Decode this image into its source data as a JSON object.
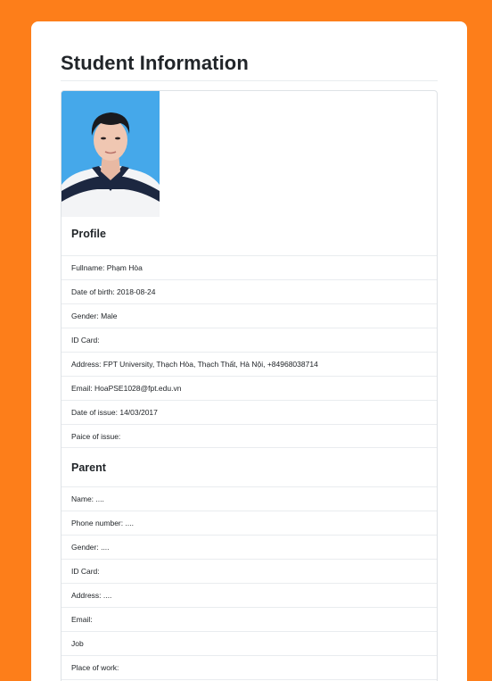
{
  "page": {
    "title": "Student Information",
    "background_color": "#fd7e1a"
  },
  "photo": {
    "alt": "student-photo"
  },
  "profile": {
    "heading": "Profile",
    "rows": [
      {
        "label": "Fullname: ",
        "value": "Phạm Hòa"
      },
      {
        "label": "Date of birth: ",
        "value": "2018-08-24"
      },
      {
        "label": "Gender: ",
        "value": "Male"
      },
      {
        "label": "ID Card: ",
        "value": ""
      },
      {
        "label": "Address: ",
        "value": "FPT University, Thạch Hòa, Thạch Thất, Hà Nội, +84968038714"
      },
      {
        "label": "Email: ",
        "value": "HoaPSE1028@fpt.edu.vn"
      },
      {
        "label": "Date of issue: ",
        "value": "14/03/2017"
      },
      {
        "label": "Paice of issue: ",
        "value": ""
      }
    ]
  },
  "parent": {
    "heading": "Parent",
    "rows": [
      {
        "label": "Name: ",
        "value": "...."
      },
      {
        "label": "Phone number: ",
        "value": "...."
      },
      {
        "label": "Gender: ",
        "value": "...."
      },
      {
        "label": "ID Card: ",
        "value": ""
      },
      {
        "label": "Address: ",
        "value": "...."
      },
      {
        "label": "Email: ",
        "value": ""
      },
      {
        "label": "Job",
        "value": ""
      },
      {
        "label": "Place of work: ",
        "value": ""
      }
    ]
  }
}
